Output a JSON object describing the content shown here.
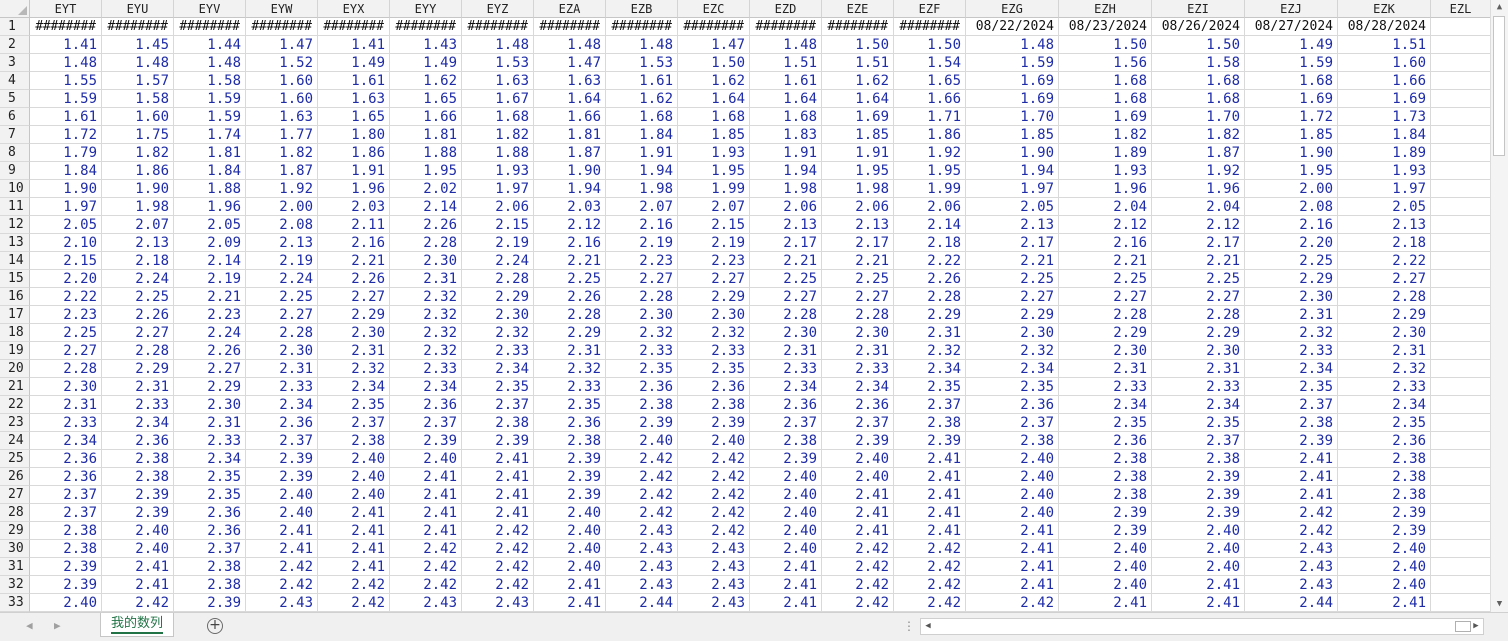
{
  "sheet": {
    "column_headers": [
      "EYT",
      "EYU",
      "EYV",
      "EYW",
      "EYX",
      "EYY",
      "EYZ",
      "EZA",
      "EZB",
      "EZC",
      "EZD",
      "EZE",
      "EZF",
      "EZG",
      "EZH",
      "EZI",
      "EZJ",
      "EZK",
      "EZL"
    ],
    "row_headers": [
      "1",
      "2",
      "3",
      "4",
      "5",
      "6",
      "7",
      "8",
      "9",
      "10",
      "11",
      "12",
      "13",
      "14",
      "15",
      "16",
      "17",
      "18",
      "19",
      "20",
      "21",
      "22",
      "23",
      "24",
      "25",
      "26",
      "27",
      "28",
      "29",
      "30",
      "31",
      "32",
      "33"
    ],
    "header_row": [
      "########",
      "########",
      "########",
      "########",
      "########",
      "########",
      "########",
      "########",
      "########",
      "########",
      "########",
      "########",
      "########",
      "08/22/2024",
      "08/23/2024",
      "08/26/2024",
      "08/27/2024",
      "08/28/2024",
      ""
    ],
    "rows": [
      [
        "1.41",
        "1.45",
        "1.44",
        "1.47",
        "1.41",
        "1.43",
        "1.48",
        "1.48",
        "1.48",
        "1.47",
        "1.48",
        "1.50",
        "1.50",
        "1.48",
        "1.50",
        "1.50",
        "1.49",
        "1.51"
      ],
      [
        "1.48",
        "1.48",
        "1.48",
        "1.52",
        "1.49",
        "1.49",
        "1.53",
        "1.47",
        "1.53",
        "1.50",
        "1.51",
        "1.51",
        "1.54",
        "1.59",
        "1.56",
        "1.58",
        "1.59",
        "1.60"
      ],
      [
        "1.55",
        "1.57",
        "1.58",
        "1.60",
        "1.61",
        "1.62",
        "1.63",
        "1.63",
        "1.61",
        "1.62",
        "1.61",
        "1.62",
        "1.65",
        "1.69",
        "1.68",
        "1.68",
        "1.68",
        "1.66"
      ],
      [
        "1.59",
        "1.58",
        "1.59",
        "1.60",
        "1.63",
        "1.65",
        "1.67",
        "1.64",
        "1.62",
        "1.64",
        "1.64",
        "1.64",
        "1.66",
        "1.69",
        "1.68",
        "1.68",
        "1.69",
        "1.69"
      ],
      [
        "1.61",
        "1.60",
        "1.59",
        "1.63",
        "1.65",
        "1.66",
        "1.68",
        "1.66",
        "1.68",
        "1.68",
        "1.68",
        "1.69",
        "1.71",
        "1.70",
        "1.69",
        "1.70",
        "1.72",
        "1.73"
      ],
      [
        "1.72",
        "1.75",
        "1.74",
        "1.77",
        "1.80",
        "1.81",
        "1.82",
        "1.81",
        "1.84",
        "1.85",
        "1.83",
        "1.85",
        "1.86",
        "1.85",
        "1.82",
        "1.82",
        "1.85",
        "1.84"
      ],
      [
        "1.79",
        "1.82",
        "1.81",
        "1.82",
        "1.86",
        "1.88",
        "1.88",
        "1.87",
        "1.91",
        "1.93",
        "1.91",
        "1.91",
        "1.92",
        "1.90",
        "1.89",
        "1.87",
        "1.90",
        "1.89"
      ],
      [
        "1.84",
        "1.86",
        "1.84",
        "1.87",
        "1.91",
        "1.95",
        "1.93",
        "1.90",
        "1.94",
        "1.95",
        "1.94",
        "1.95",
        "1.95",
        "1.94",
        "1.93",
        "1.92",
        "1.95",
        "1.93"
      ],
      [
        "1.90",
        "1.90",
        "1.88",
        "1.92",
        "1.96",
        "2.02",
        "1.97",
        "1.94",
        "1.98",
        "1.99",
        "1.98",
        "1.98",
        "1.99",
        "1.97",
        "1.96",
        "1.96",
        "2.00",
        "1.97"
      ],
      [
        "1.97",
        "1.98",
        "1.96",
        "2.00",
        "2.03",
        "2.14",
        "2.06",
        "2.03",
        "2.07",
        "2.07",
        "2.06",
        "2.06",
        "2.06",
        "2.05",
        "2.04",
        "2.04",
        "2.08",
        "2.05"
      ],
      [
        "2.05",
        "2.07",
        "2.05",
        "2.08",
        "2.11",
        "2.26",
        "2.15",
        "2.12",
        "2.16",
        "2.15",
        "2.13",
        "2.13",
        "2.14",
        "2.13",
        "2.12",
        "2.12",
        "2.16",
        "2.13"
      ],
      [
        "2.10",
        "2.13",
        "2.09",
        "2.13",
        "2.16",
        "2.28",
        "2.19",
        "2.16",
        "2.19",
        "2.19",
        "2.17",
        "2.17",
        "2.18",
        "2.17",
        "2.16",
        "2.17",
        "2.20",
        "2.18"
      ],
      [
        "2.15",
        "2.18",
        "2.14",
        "2.19",
        "2.21",
        "2.30",
        "2.24",
        "2.21",
        "2.23",
        "2.23",
        "2.21",
        "2.21",
        "2.22",
        "2.21",
        "2.21",
        "2.21",
        "2.25",
        "2.22"
      ],
      [
        "2.20",
        "2.24",
        "2.19",
        "2.24",
        "2.26",
        "2.31",
        "2.28",
        "2.25",
        "2.27",
        "2.27",
        "2.25",
        "2.25",
        "2.26",
        "2.25",
        "2.25",
        "2.25",
        "2.29",
        "2.27"
      ],
      [
        "2.22",
        "2.25",
        "2.21",
        "2.25",
        "2.27",
        "2.32",
        "2.29",
        "2.26",
        "2.28",
        "2.29",
        "2.27",
        "2.27",
        "2.28",
        "2.27",
        "2.27",
        "2.27",
        "2.30",
        "2.28"
      ],
      [
        "2.23",
        "2.26",
        "2.23",
        "2.27",
        "2.29",
        "2.32",
        "2.30",
        "2.28",
        "2.30",
        "2.30",
        "2.28",
        "2.28",
        "2.29",
        "2.29",
        "2.28",
        "2.28",
        "2.31",
        "2.29"
      ],
      [
        "2.25",
        "2.27",
        "2.24",
        "2.28",
        "2.30",
        "2.32",
        "2.32",
        "2.29",
        "2.32",
        "2.32",
        "2.30",
        "2.30",
        "2.31",
        "2.30",
        "2.29",
        "2.29",
        "2.32",
        "2.30"
      ],
      [
        "2.27",
        "2.28",
        "2.26",
        "2.30",
        "2.31",
        "2.32",
        "2.33",
        "2.31",
        "2.33",
        "2.33",
        "2.31",
        "2.31",
        "2.32",
        "2.32",
        "2.30",
        "2.30",
        "2.33",
        "2.31"
      ],
      [
        "2.28",
        "2.29",
        "2.27",
        "2.31",
        "2.32",
        "2.33",
        "2.34",
        "2.32",
        "2.35",
        "2.35",
        "2.33",
        "2.33",
        "2.34",
        "2.34",
        "2.31",
        "2.31",
        "2.34",
        "2.32"
      ],
      [
        "2.30",
        "2.31",
        "2.29",
        "2.33",
        "2.34",
        "2.34",
        "2.35",
        "2.33",
        "2.36",
        "2.36",
        "2.34",
        "2.34",
        "2.35",
        "2.35",
        "2.33",
        "2.33",
        "2.35",
        "2.33"
      ],
      [
        "2.31",
        "2.33",
        "2.30",
        "2.34",
        "2.35",
        "2.36",
        "2.37",
        "2.35",
        "2.38",
        "2.38",
        "2.36",
        "2.36",
        "2.37",
        "2.36",
        "2.34",
        "2.34",
        "2.37",
        "2.34"
      ],
      [
        "2.33",
        "2.34",
        "2.31",
        "2.36",
        "2.37",
        "2.37",
        "2.38",
        "2.36",
        "2.39",
        "2.39",
        "2.37",
        "2.37",
        "2.38",
        "2.37",
        "2.35",
        "2.35",
        "2.38",
        "2.35"
      ],
      [
        "2.34",
        "2.36",
        "2.33",
        "2.37",
        "2.38",
        "2.39",
        "2.39",
        "2.38",
        "2.40",
        "2.40",
        "2.38",
        "2.39",
        "2.39",
        "2.38",
        "2.36",
        "2.37",
        "2.39",
        "2.36"
      ],
      [
        "2.36",
        "2.38",
        "2.34",
        "2.39",
        "2.40",
        "2.40",
        "2.41",
        "2.39",
        "2.42",
        "2.42",
        "2.39",
        "2.40",
        "2.41",
        "2.40",
        "2.38",
        "2.38",
        "2.41",
        "2.38"
      ],
      [
        "2.36",
        "2.38",
        "2.35",
        "2.39",
        "2.40",
        "2.41",
        "2.41",
        "2.39",
        "2.42",
        "2.42",
        "2.40",
        "2.40",
        "2.41",
        "2.40",
        "2.38",
        "2.39",
        "2.41",
        "2.38"
      ],
      [
        "2.37",
        "2.39",
        "2.35",
        "2.40",
        "2.40",
        "2.41",
        "2.41",
        "2.39",
        "2.42",
        "2.42",
        "2.40",
        "2.41",
        "2.41",
        "2.40",
        "2.38",
        "2.39",
        "2.41",
        "2.38"
      ],
      [
        "2.37",
        "2.39",
        "2.36",
        "2.40",
        "2.41",
        "2.41",
        "2.41",
        "2.40",
        "2.42",
        "2.42",
        "2.40",
        "2.41",
        "2.41",
        "2.40",
        "2.39",
        "2.39",
        "2.42",
        "2.39"
      ],
      [
        "2.38",
        "2.40",
        "2.36",
        "2.41",
        "2.41",
        "2.41",
        "2.42",
        "2.40",
        "2.43",
        "2.42",
        "2.40",
        "2.41",
        "2.41",
        "2.41",
        "2.39",
        "2.40",
        "2.42",
        "2.39"
      ],
      [
        "2.38",
        "2.40",
        "2.37",
        "2.41",
        "2.41",
        "2.42",
        "2.42",
        "2.40",
        "2.43",
        "2.43",
        "2.40",
        "2.42",
        "2.42",
        "2.41",
        "2.40",
        "2.40",
        "2.43",
        "2.40"
      ],
      [
        "2.39",
        "2.41",
        "2.38",
        "2.42",
        "2.41",
        "2.42",
        "2.42",
        "2.40",
        "2.43",
        "2.43",
        "2.41",
        "2.42",
        "2.42",
        "2.41",
        "2.40",
        "2.40",
        "2.43",
        "2.40"
      ],
      [
        "2.39",
        "2.41",
        "2.38",
        "2.42",
        "2.42",
        "2.42",
        "2.42",
        "2.41",
        "2.43",
        "2.43",
        "2.41",
        "2.42",
        "2.42",
        "2.41",
        "2.40",
        "2.41",
        "2.43",
        "2.40"
      ],
      [
        "2.40",
        "2.42",
        "2.39",
        "2.43",
        "2.42",
        "2.43",
        "2.43",
        "2.41",
        "2.44",
        "2.43",
        "2.41",
        "2.42",
        "2.42",
        "2.42",
        "2.41",
        "2.41",
        "2.44",
        "2.41"
      ]
    ]
  },
  "tabs": [
    {
      "label": "我的数列",
      "active": true
    }
  ],
  "icons": {
    "add_sheet": "plus-circle-icon",
    "sheet_nav_prev": "chevron-left-icon",
    "sheet_nav_next": "chevron-right-icon",
    "scroll_up": "triangle-up-icon",
    "scroll_down": "triangle-down-icon",
    "scroll_left": "triangle-left-icon",
    "scroll_right": "triangle-right-icon",
    "split_handle": "vertical-dots-icon"
  },
  "colors": {
    "number_text": "#1f2ca8",
    "header_text": "#111111",
    "tab_accent": "#217346",
    "header_bg": "#f2f2f2"
  }
}
